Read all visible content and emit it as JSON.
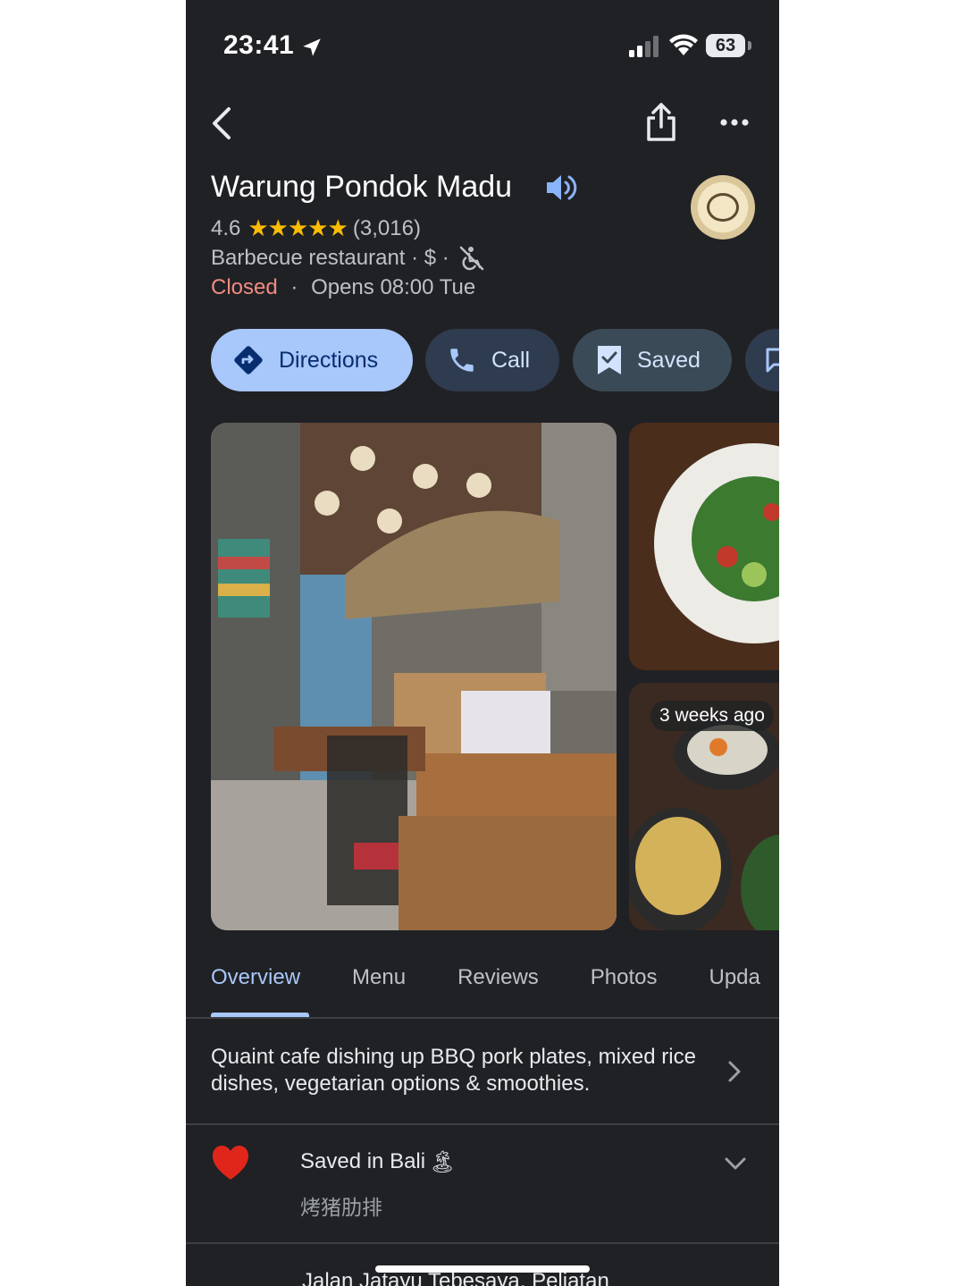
{
  "status_bar": {
    "time": "23:41",
    "battery": "63"
  },
  "place": {
    "name": "Warung Pondok Madu",
    "rating": "4.6",
    "stars_display": "★★★★★",
    "review_count": "(3,016)",
    "category": "Barbecue restaurant · $ ·",
    "status": "Closed",
    "separator": "·",
    "opens": "Opens 08:00 Tue"
  },
  "actions": {
    "directions": "Directions",
    "call": "Call",
    "saved": "Saved"
  },
  "photos": {
    "badge": "3 weeks ago"
  },
  "tabs": [
    "Overview",
    "Menu",
    "Reviews",
    "Photos",
    "Upda"
  ],
  "overview": {
    "description": "Quaint cafe dishing up BBQ pork plates, mixed rice dishes, vegetarian options & smoothies."
  },
  "saved": {
    "list_name": "Saved in Bali",
    "list_emoji": "🏝",
    "note": "烤猪肋排"
  },
  "address": "Jalan Jatayu Tebesaya, Peliatan",
  "colors": {
    "background": "#202124",
    "accent": "#a8c7fa",
    "closed": "#f28b82",
    "stars": "#fbbc04"
  }
}
